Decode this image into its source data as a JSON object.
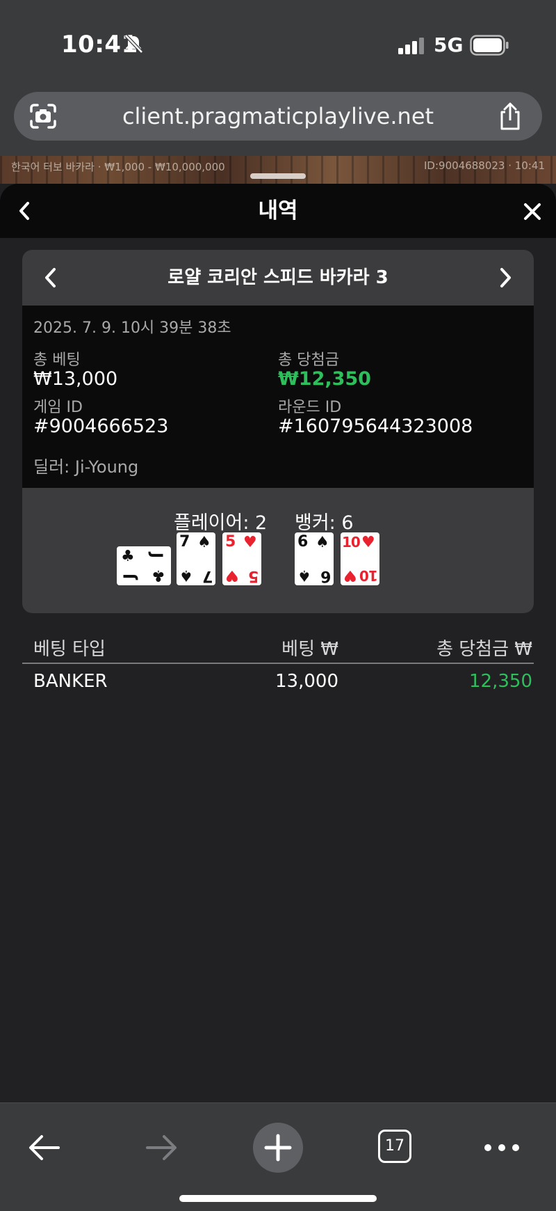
{
  "status_bar": {
    "time": "10:41",
    "network": "5G"
  },
  "browser": {
    "url": "client.pragmaticplaylive.net",
    "tab_count": "17"
  },
  "game_strip": {
    "left_text": "한국어 터보 바카라 · ₩1,000 - ₩10,000,000",
    "right_text": "ID:9004688023 · 10:41"
  },
  "panel": {
    "title": "내역"
  },
  "game": {
    "title": "로얄 코리안 스피드 바카라 3",
    "datetime": "2025. 7. 9. 10시 39분 38초",
    "total_bet_label": "총 베팅",
    "total_bet": "₩13,000",
    "total_win_label": "총 당첨금",
    "total_win": "₩12,350",
    "game_id_label": "게임 ID",
    "game_id": "#9004666523",
    "round_id_label": "라운드 ID",
    "round_id": "#160795644323008",
    "dealer": "딜러: Ji-Young"
  },
  "result": {
    "player_label": "플레이어: 2",
    "banker_label": "뱅커: 6",
    "player_cards": [
      {
        "rank": "J",
        "suit": "♣",
        "color": "black",
        "orientation": "sideways"
      },
      {
        "rank": "7",
        "suit": "♠",
        "color": "black"
      },
      {
        "rank": "5",
        "suit": "♥",
        "color": "red"
      }
    ],
    "banker_cards": [
      {
        "rank": "6",
        "suit": "♠",
        "color": "black"
      },
      {
        "rank": "10",
        "suit": "♥",
        "color": "red"
      }
    ]
  },
  "bets": {
    "headers": [
      "베팅 타입",
      "베팅 ₩",
      "총 당첨금 ₩"
    ],
    "rows": [
      {
        "type": "BANKER",
        "bet": "13,000",
        "win": "12,350"
      }
    ]
  },
  "colors": {
    "win_green": "#2fbe5c",
    "card_red": "#e8232f"
  }
}
